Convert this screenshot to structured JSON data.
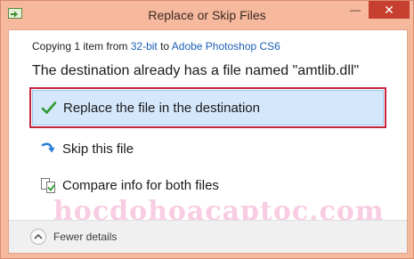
{
  "window": {
    "title": "Replace or Skip Files",
    "minimize_label": "—",
    "close_label": "✕"
  },
  "copy": {
    "prefix": "Copying 1 item from ",
    "source": "32-bit",
    "middle": " to ",
    "destination": "Adobe Photoshop CS6"
  },
  "message": "The destination already has a file named \"amtlib.dll\"",
  "options": [
    {
      "label": "Replace the file in the destination",
      "icon": "checkmark-icon",
      "selected": true
    },
    {
      "label": "Skip this file",
      "icon": "skip-arrow-icon",
      "selected": false
    },
    {
      "label": "Compare info for both files",
      "icon": "compare-files-icon",
      "selected": false
    }
  ],
  "watermark": "hocdohoacaptoc.com",
  "footer": {
    "fewer_details": "Fewer details"
  },
  "colors": {
    "frame": "#f6b99e",
    "close": "#c7402f",
    "selected_bg": "#d5e8fb",
    "highlight_box": "#c4253a",
    "link": "#1a5fb4"
  }
}
